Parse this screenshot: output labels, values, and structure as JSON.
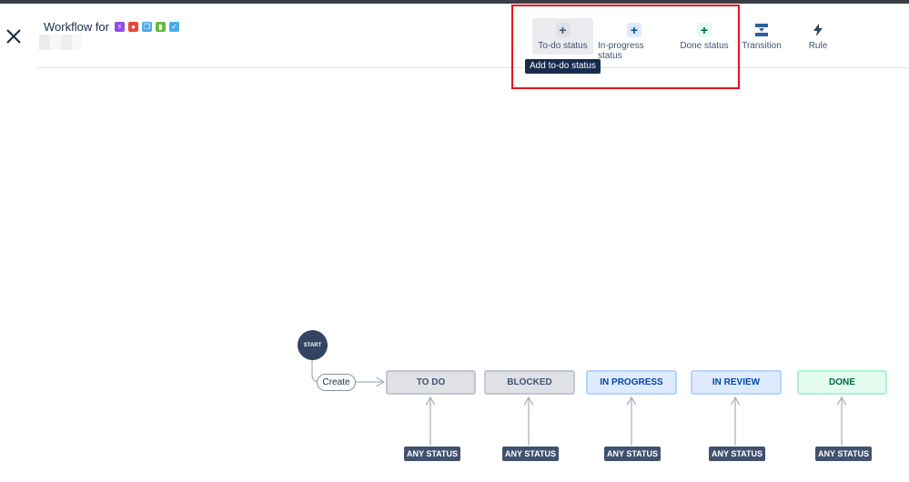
{
  "header": {
    "title": "Workflow for",
    "issue_type_icons": [
      {
        "name": "epic-icon",
        "color": "#904ee2",
        "glyph": "⚡"
      },
      {
        "name": "bug-icon",
        "color": "#e5493a",
        "glyph": "●"
      },
      {
        "name": "subtask-icon",
        "color": "#4bade8",
        "glyph": "❐"
      },
      {
        "name": "story-icon",
        "color": "#63ba3c",
        "glyph": "▮"
      },
      {
        "name": "task-icon",
        "color": "#4bade8",
        "glyph": "✓"
      }
    ]
  },
  "toolbar": {
    "todo_label": "To-do status",
    "inprogress_label": "In-progress status",
    "done_label": "Done status",
    "transition_label": "Transition",
    "rule_label": "Rule",
    "plus_glyph": "+",
    "tooltip": "Add to-do status"
  },
  "diagram": {
    "start_label": "START",
    "create_label": "Create",
    "statuses": [
      {
        "label": "TO DO",
        "category": "todo"
      },
      {
        "label": "BLOCKED",
        "category": "todo"
      },
      {
        "label": "IN PROGRESS",
        "category": "inprogress"
      },
      {
        "label": "IN REVIEW",
        "category": "inprogress"
      },
      {
        "label": "DONE",
        "category": "done"
      }
    ],
    "any_status_label": "ANY STATUS"
  },
  "colors": {
    "highlight": "#e3121b",
    "todo": "#dfe1e6",
    "inprogress": "#deebff",
    "done": "#e3fcef",
    "start": "#344563"
  }
}
